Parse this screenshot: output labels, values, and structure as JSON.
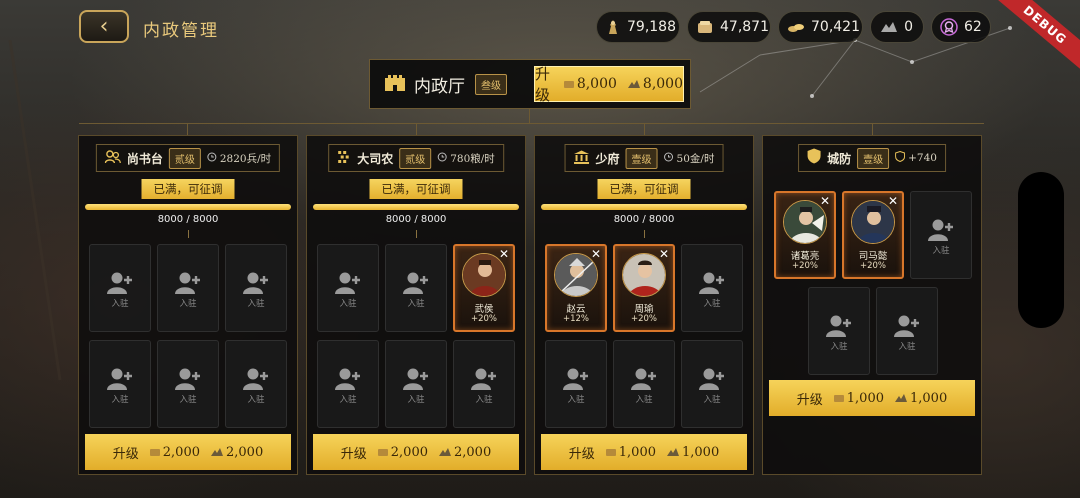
{
  "header": {
    "title": "内政管理",
    "back_icon": "chevron-left-icon"
  },
  "resources": [
    {
      "icon": "soldier-icon",
      "value": "79,188"
    },
    {
      "icon": "grain-icon",
      "value": "47,871"
    },
    {
      "icon": "gold-icon",
      "value": "70,421"
    },
    {
      "icon": "ore-icon",
      "value": "0"
    },
    {
      "icon": "badge-icon",
      "value": "62"
    }
  ],
  "debug_label": "DEBUG",
  "hall": {
    "name": "内政厅",
    "level": "叁级",
    "upgrade_label": "升级",
    "cost_grain": "8,000",
    "cost_ore": "8,000"
  },
  "slot_label": "入驻",
  "panels": [
    {
      "name": "尚书台",
      "level": "贰级",
      "production": "2820兵/时",
      "status": "已满，可征调",
      "progress_text": "8000 / 8000",
      "progress": 1.0,
      "heroes": [],
      "upgrade_label": "升级",
      "cost_grain": "2,000",
      "cost_ore": "2,000"
    },
    {
      "name": "大司农",
      "level": "贰级",
      "production": "780粮/时",
      "status": "已满，可征调",
      "progress_text": "8000 / 8000",
      "progress": 1.0,
      "heroes": [
        {
          "name": "武侯",
          "bonus": "+20%"
        }
      ],
      "upgrade_label": "升级",
      "cost_grain": "2,000",
      "cost_ore": "2,000"
    },
    {
      "name": "少府",
      "level": "壹级",
      "production": "50金/时",
      "status": "已满，可征调",
      "progress_text": "8000 / 8000",
      "progress": 1.0,
      "heroes": [
        {
          "name": "赵云",
          "bonus": "+12%"
        },
        {
          "name": "周瑜",
          "bonus": "+20%"
        }
      ],
      "upgrade_label": "升级",
      "cost_grain": "1,000",
      "cost_ore": "1,000"
    },
    {
      "name": "城防",
      "level": "壹级",
      "production": "+740",
      "heroes": [
        {
          "name": "诸葛亮",
          "bonus": "+20%"
        },
        {
          "name": "司马懿",
          "bonus": "+20%"
        }
      ],
      "upgrade_label": "升级",
      "cost_grain": "1,000",
      "cost_ore": "1,000"
    }
  ]
}
